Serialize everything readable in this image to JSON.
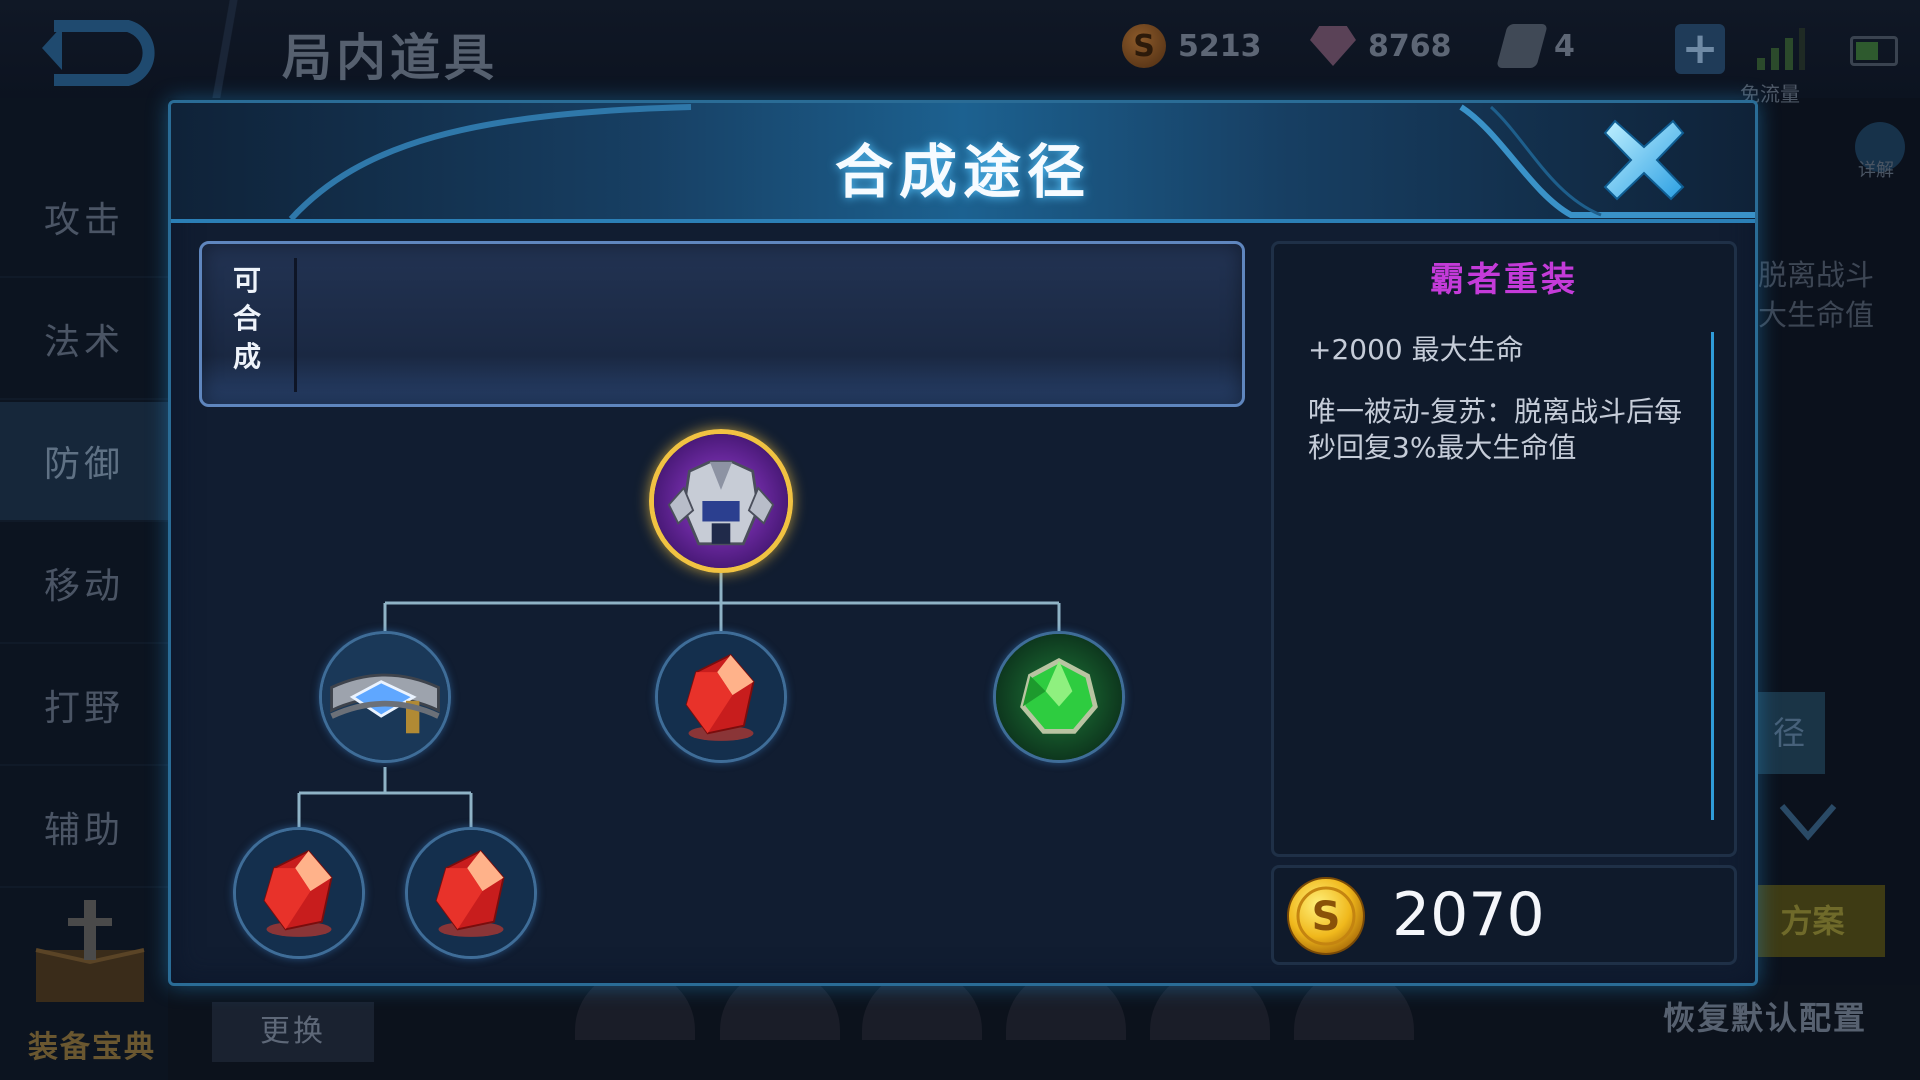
{
  "top_bar": {
    "title": "局内道具",
    "gold_amount": "5213",
    "diamond_amount": "8768",
    "voucher_amount": "4",
    "plus_label": "+",
    "signal_label": "免流量",
    "gold_symbol": "S"
  },
  "sidebar": {
    "items": [
      {
        "label": "攻击"
      },
      {
        "label": "法术"
      },
      {
        "label": "防御"
      },
      {
        "label": "移动"
      },
      {
        "label": "打野"
      },
      {
        "label": "辅助"
      }
    ],
    "active_index": 2,
    "book_label": "装备宝典"
  },
  "bottom": {
    "change_label": "更换",
    "restore_label": "恢复默认配置"
  },
  "right_edge": {
    "detail_label": "详解",
    "ghost_line1": "脱离战斗",
    "ghost_line2": "大生命值",
    "path_label": "径",
    "plan_label": "方案"
  },
  "modal": {
    "title": "合成途径",
    "composable_label": "可合成",
    "item_name": "霸者重装",
    "item_name_color": "#c43bd9",
    "stat": "+2000 最大生命",
    "passive": "唯一被动-复苏：脱离战斗后每秒回复3%最大生命值",
    "price": "2070",
    "coin_symbol": "S",
    "tree": {
      "root": {
        "icon": "heavy-armor-icon"
      },
      "children": [
        {
          "icon": "belt-icon",
          "children": [
            {
              "icon": "red-crystal-icon"
            },
            {
              "icon": "red-crystal-icon"
            }
          ]
        },
        {
          "icon": "red-crystal-icon"
        },
        {
          "icon": "green-gem-icon"
        }
      ]
    }
  },
  "colors": {
    "accent": "#2b7fb6",
    "gold_border": "#f1c242",
    "title_glow": "#56c6ff"
  }
}
